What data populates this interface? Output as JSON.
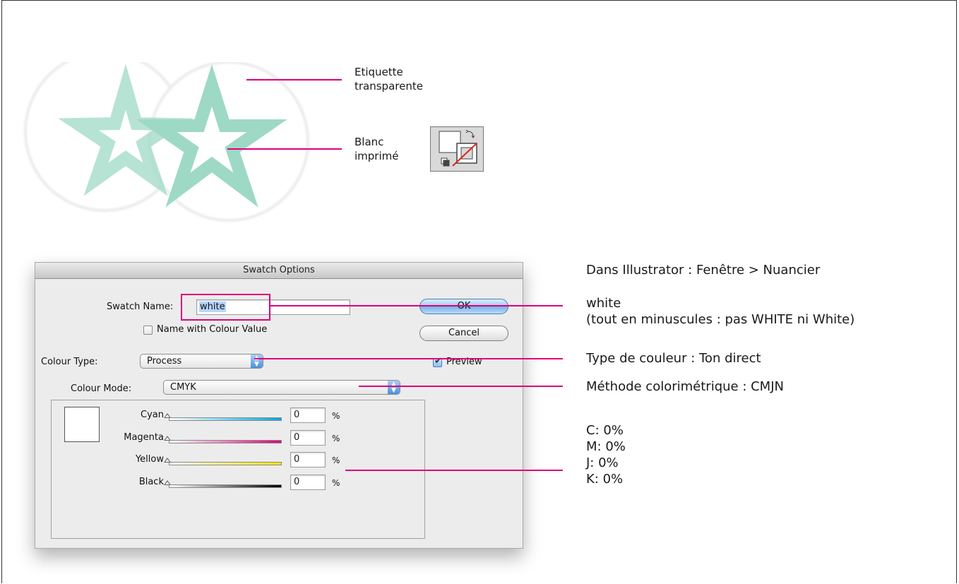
{
  "labels": {
    "transparent": [
      "Etiquette",
      "transparente"
    ],
    "printed_white": [
      "Blanc",
      "imprimé"
    ]
  },
  "annotations": {
    "menu_path": "Dans Illustrator : Fenêtre > Nuancier",
    "name_note": [
      "white",
      "(tout en minuscules : pas WHITE ni White)"
    ],
    "type_note": "Type de couleur : Ton direct",
    "mode_note": "Méthode colorimétrique : CMJN",
    "values_note": [
      "C: 0%",
      "M: 0%",
      "J: 0%",
      "K: 0%"
    ]
  },
  "dialog": {
    "title": "Swatch Options",
    "swatch_name_label": "Swatch Name:",
    "swatch_name_value": "white",
    "name_with_colour_value": "Name with Colour Value",
    "colour_type_label": "Colour Type:",
    "colour_type_value": "Process",
    "colour_mode_label": "Colour Mode:",
    "colour_mode_value": "CMYK",
    "ok": "OK",
    "cancel": "Cancel",
    "preview": "Preview",
    "preview_checked": true,
    "name_with_colour_value_checked": false,
    "sliders": [
      {
        "label": "Cyan",
        "value": "0",
        "unit": "%",
        "color": "#00a9e0"
      },
      {
        "label": "Magenta",
        "value": "0",
        "unit": "%",
        "color": "#e0007a"
      },
      {
        "label": "Yellow",
        "value": "0",
        "unit": "%",
        "color": "#ffe600"
      },
      {
        "label": "Black",
        "value": "0",
        "unit": "%",
        "color": "#000000"
      }
    ]
  },
  "colors": {
    "accent_line": "#e0007a",
    "star": "#9ed9c6",
    "dialog_bg": "#ececec"
  }
}
